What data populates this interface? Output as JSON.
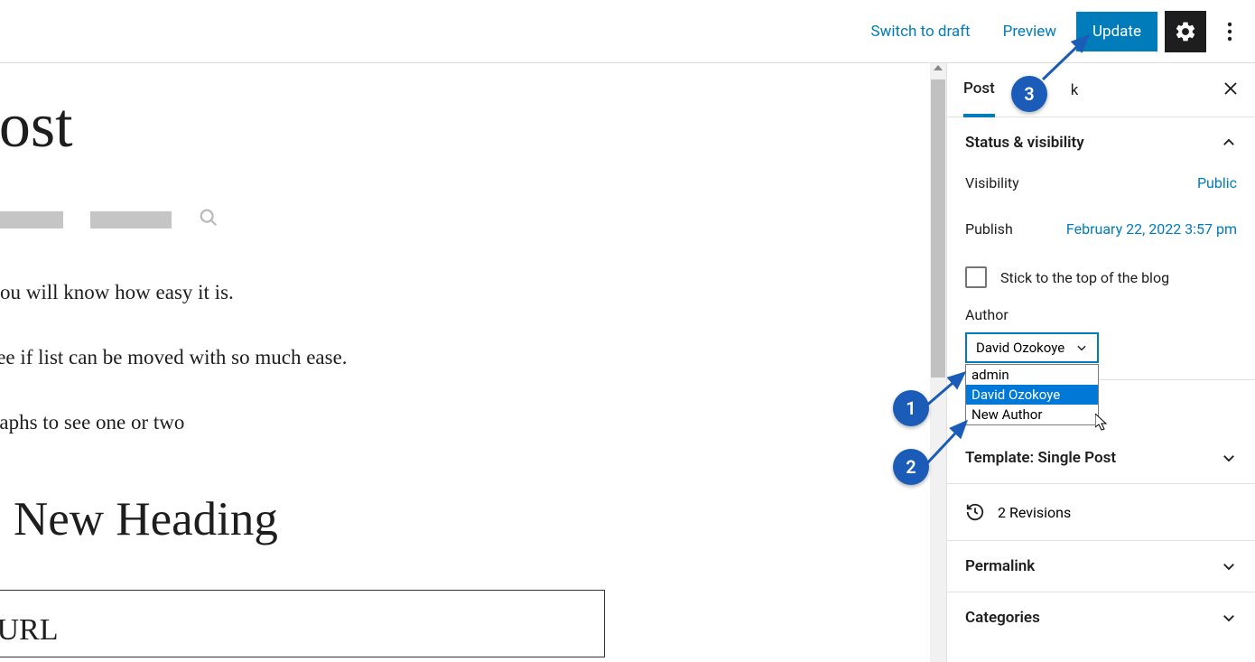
{
  "topbar": {
    "switch_to_draft": "Switch to draft",
    "preview": "Preview",
    "update": "Update"
  },
  "tabs": {
    "post": "Post",
    "block": "k"
  },
  "status_panel": {
    "title": "Status & visibility",
    "visibility_label": "Visibility",
    "visibility_value": "Public",
    "publish_label": "Publish",
    "publish_value": "February 22, 2022 3:57 pm",
    "stick_label": "Stick to the top of the blog",
    "author_label": "Author",
    "author_selected": "David Ozokoye",
    "author_options": [
      "admin",
      "David Ozokoye",
      "New Author"
    ]
  },
  "template_panel": {
    "title": "Template: Single Post"
  },
  "revisions": {
    "label": "2 Revisions"
  },
  "permalink_panel": {
    "title": "Permalink"
  },
  "categories_panel": {
    "title": "Categories"
  },
  "editor": {
    "title": "Post",
    "para1": "it you will know how easy it is.",
    "para2": "o see if list can be moved with so much ease.",
    "para3": "agraphs to see one or two",
    "heading": "New Heading",
    "box_heading": "d URL"
  },
  "annotations": {
    "one": "1",
    "two": "2",
    "three": "3"
  }
}
